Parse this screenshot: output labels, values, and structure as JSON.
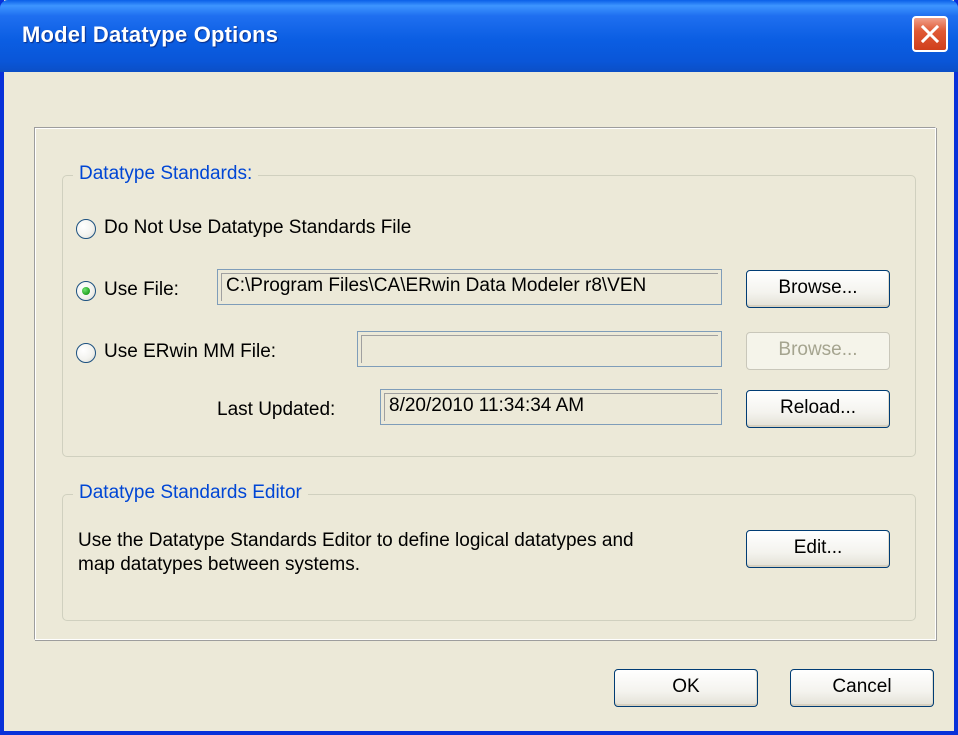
{
  "window": {
    "title": "Model Datatype Options"
  },
  "datatype_standards": {
    "legend": "Datatype Standards:",
    "option_do_not_use": "Do Not Use Datatype Standards File",
    "option_use_file": "Use File:",
    "use_file_path": "C:\\Program Files\\CA\\ERwin Data Modeler r8\\VEN",
    "browse_label": "Browse...",
    "option_use_mm_file": "Use ERwin MM File:",
    "mm_file_path": "",
    "browse_mm_label": "Browse...",
    "last_updated_label": "Last Updated:",
    "last_updated_value": "8/20/2010 11:34:34 AM",
    "reload_label": "Reload...",
    "selected_option": "use_file"
  },
  "editor": {
    "legend": "Datatype Standards Editor",
    "description_line1": "Use the Datatype Standards Editor to define logical datatypes and",
    "description_line2": "map datatypes between systems.",
    "edit_label": "Edit..."
  },
  "footer": {
    "ok_label": "OK",
    "cancel_label": "Cancel"
  },
  "icons": {
    "close": "close-icon"
  },
  "colors": {
    "title_bar": "#0a5fe8",
    "group_legend": "#0046d5",
    "close_button": "#e05a36"
  }
}
